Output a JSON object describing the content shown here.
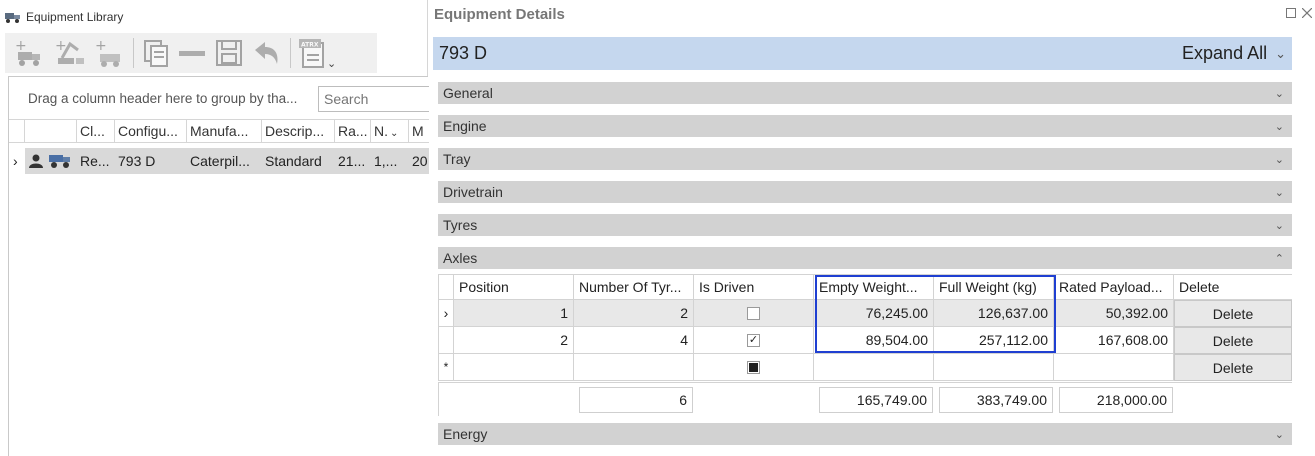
{
  "left": {
    "title": "Equipment Library",
    "toolbar": {
      "icons": [
        "add-truck-icon",
        "add-excavator-icon",
        "add-equipment-icon",
        "copy-icon",
        "remove-icon",
        "save-icon",
        "undo-icon",
        "atrx-export-icon",
        "dropdown-caret-icon"
      ],
      "atrx_label": "ATRX",
      "caret": "⌄"
    },
    "group_hint": "Drag a column header here to group by tha...",
    "search_placeholder": "Search",
    "columns": [
      "Cl...",
      "Configu...",
      "Manufa...",
      "Descrip...",
      "Ra...",
      "N.",
      "M"
    ],
    "sort_indicator": "⌄",
    "row": {
      "expander": "›",
      "class": "Re...",
      "configuration": "793 D",
      "manufacturer": "Caterpil...",
      "description": "Standard",
      "rating": "21...",
      "n": "1,...",
      "m": "20"
    }
  },
  "right": {
    "title": "Equipment Details",
    "banner_title": "793 D",
    "expand_all": "Expand All",
    "chev_down": "⌄",
    "chev_up": "⌃",
    "sections": {
      "general": "General",
      "engine": "Engine",
      "tray": "Tray",
      "drivetrain": "Drivetrain",
      "tyres": "Tyres",
      "axles": "Axles",
      "energy": "Energy"
    },
    "axles": {
      "headers": {
        "position": "Position",
        "tyres": "Number Of Tyr...",
        "driven": "Is Driven",
        "empty": "Empty Weight...",
        "full": "Full Weight (kg)",
        "payload": "Rated Payload...",
        "delete": "Delete"
      },
      "rows": [
        {
          "indicator": "›",
          "position": "1",
          "tyres": "2",
          "driven": false,
          "empty": "76,245.00",
          "full": "126,637.00",
          "payload": "50,392.00",
          "delete": "Delete"
        },
        {
          "indicator": "",
          "position": "2",
          "tyres": "4",
          "driven": true,
          "empty": "89,504.00",
          "full": "257,112.00",
          "payload": "167,608.00",
          "delete": "Delete"
        },
        {
          "indicator": "*",
          "position": "",
          "tyres": "",
          "driven": null,
          "empty": "",
          "full": "",
          "payload": "",
          "delete": "Delete"
        }
      ],
      "totals": {
        "tyres": "6",
        "empty": "165,749.00",
        "full": "383,749.00",
        "payload": "218,000.00"
      },
      "check_mark": "✓"
    }
  }
}
